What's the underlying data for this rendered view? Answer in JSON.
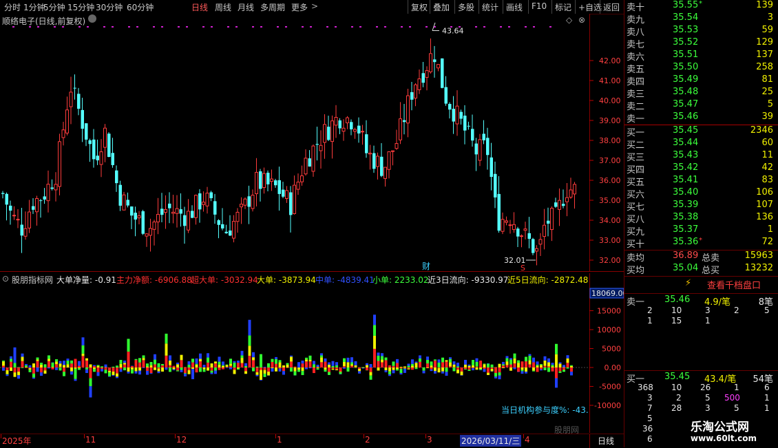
{
  "toolbar": {
    "periods": [
      "分时",
      "1分钟",
      "5分钟",
      "15分钟",
      "30分钟",
      "60分钟",
      "日线",
      "周线",
      "月线",
      "多周期",
      "更多"
    ],
    "active_period": "日线",
    "actions": [
      "复权",
      "叠加",
      "多股",
      "统计",
      "画线",
      "F10",
      "标记",
      "+自选",
      "返回"
    ]
  },
  "chart_title": "顺络电子(日线,前复权)",
  "price_axis": {
    "ticks": [
      "42.00",
      "41.00",
      "40.00",
      "39.00",
      "38.00",
      "37.00",
      "36.00",
      "35.00",
      "34.00",
      "33.00",
      "32.00"
    ]
  },
  "annotations": {
    "high": "43.64",
    "low": "32.01",
    "cai": "财",
    "s_marker": "S"
  },
  "indicator": {
    "name": "股朋指标网",
    "items": [
      {
        "label": "大单净量:",
        "value": "-0.91",
        "color": "#e8e8e8"
      },
      {
        "label": "主力净额:",
        "value": "-6906.88",
        "color": "#ff3030"
      },
      {
        "label": "超大单:",
        "value": "-3032.94",
        "color": "#ff3030"
      },
      {
        "label": "大单:",
        "value": "-3873.94",
        "color": "#f0f000"
      },
      {
        "label": "中单:",
        "value": "-4839.41",
        "color": "#3050ff"
      },
      {
        "label": "小单:",
        "value": "2233.02",
        "color": "#3cff3c"
      },
      {
        "label": "近3日流向:",
        "value": "-9330.97",
        "color": "#e8e8e8"
      },
      {
        "label": "近5日流向:",
        "value": "-2872.48",
        "color": "#f0f000"
      }
    ],
    "ratio_label": "当日机构参与度%: -43.",
    "watermark": "股朋网"
  },
  "vol_axis": {
    "top_value": "18069.00",
    "ticks": [
      "15000",
      "10000",
      "5000",
      "0.00",
      "-5000",
      "-10000"
    ]
  },
  "date_axis": {
    "labels": [
      "2025年",
      "11",
      "12",
      "1",
      "2",
      "3",
      "2026/03/11/三",
      "4"
    ],
    "period": "日线"
  },
  "order_book": {
    "asks": [
      {
        "label": "卖十",
        "price": "35.55",
        "vol": "139",
        "star": "*"
      },
      {
        "label": "卖九",
        "price": "35.54",
        "vol": "3"
      },
      {
        "label": "卖八",
        "price": "35.53",
        "vol": "59"
      },
      {
        "label": "卖七",
        "price": "35.52",
        "vol": "129"
      },
      {
        "label": "卖六",
        "price": "35.51",
        "vol": "137"
      },
      {
        "label": "卖五",
        "price": "35.50",
        "vol": "258"
      },
      {
        "label": "卖四",
        "price": "35.49",
        "vol": "81"
      },
      {
        "label": "卖三",
        "price": "35.48",
        "vol": "25"
      },
      {
        "label": "卖二",
        "price": "35.47",
        "vol": "5"
      },
      {
        "label": "卖一",
        "price": "35.46",
        "vol": "39"
      }
    ],
    "bids": [
      {
        "label": "买一",
        "price": "35.45",
        "vol": "2346"
      },
      {
        "label": "买二",
        "price": "35.44",
        "vol": "60"
      },
      {
        "label": "买三",
        "price": "35.43",
        "vol": "11"
      },
      {
        "label": "买四",
        "price": "35.42",
        "vol": "42"
      },
      {
        "label": "买五",
        "price": "35.41",
        "vol": "83"
      },
      {
        "label": "买六",
        "price": "35.40",
        "vol": "106"
      },
      {
        "label": "买七",
        "price": "35.39",
        "vol": "107"
      },
      {
        "label": "买八",
        "price": "35.38",
        "vol": "136"
      },
      {
        "label": "买九",
        "price": "35.37",
        "vol": "1"
      },
      {
        "label": "买十",
        "price": "35.36",
        "vol": "72",
        "star": "*"
      }
    ],
    "avg": [
      {
        "label": "卖均",
        "price": "36.89",
        "total_label": "总卖",
        "total": "15963"
      },
      {
        "label": "买均",
        "price": "35.04",
        "total_label": "总买",
        "total": "13232"
      }
    ],
    "thousand_btn": "查看千档盘口",
    "sell1_detail": {
      "label": "卖一",
      "price": "35.46",
      "avg": "4.9/笔",
      "count": "8笔",
      "queue": [
        [
          "2",
          "10",
          "3",
          "2",
          "5"
        ],
        [
          "1",
          "15",
          "1",
          "",
          ""
        ]
      ]
    },
    "buy1_detail": {
      "label": "买一",
      "price": "35.45",
      "avg": "43.4/笔",
      "count": "54笔",
      "queue": [
        [
          "368",
          "10",
          "26",
          "1",
          "6"
        ],
        [
          "3",
          "2",
          "5",
          "500",
          "1"
        ],
        [
          "7",
          "28",
          "3",
          "5",
          "1"
        ],
        [
          "5",
          "",
          "",
          "",
          ""
        ],
        [
          "36",
          "",
          "",
          "",
          ""
        ],
        [
          "6",
          "",
          "",
          "",
          ""
        ]
      ]
    }
  },
  "brand": {
    "name": "乐淘公式网",
    "url": "www.60lt.com"
  },
  "colors": {
    "up": "#ff3c3c",
    "down": "#54ffff",
    "bg": "#000000"
  }
}
